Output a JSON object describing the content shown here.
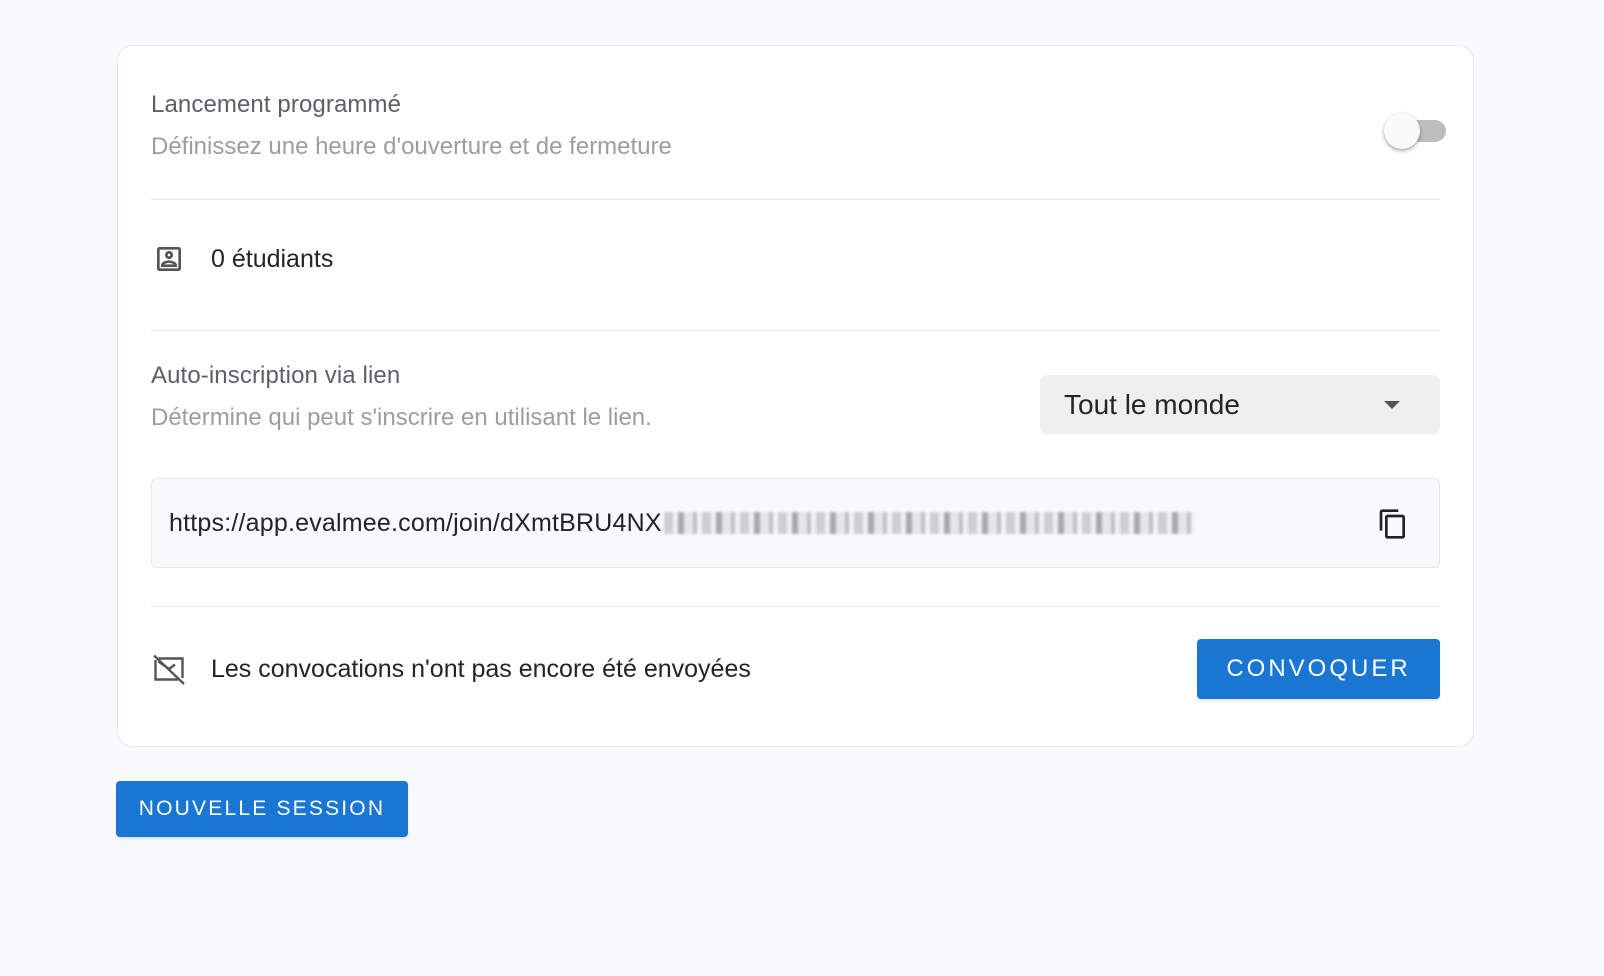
{
  "scheduled_launch": {
    "title": "Lancement programmé",
    "subtitle": "Définissez une heure d'ouverture et de fermeture",
    "enabled": false
  },
  "students": {
    "icon": "account-box-icon",
    "count_label": "0 étudiants"
  },
  "self_enrollment": {
    "title": "Auto-inscription via lien",
    "subtitle": "Détermine qui peut s'inscrire en utilisant le lien.",
    "selected_option": "Tout le monde",
    "link": "https://app.evalmee.com/join/dXmtBRU4NX",
    "copy_icon": "copy-icon"
  },
  "invitations": {
    "icon": "mail-off-icon",
    "status_text": "Les convocations n'ont pas encore été envoyées",
    "button_label": "Convoquer"
  },
  "new_session_button": "Nouvelle session",
  "colors": {
    "primary": "#1976d2",
    "background": "#f8f9fd",
    "card": "#ffffff"
  }
}
